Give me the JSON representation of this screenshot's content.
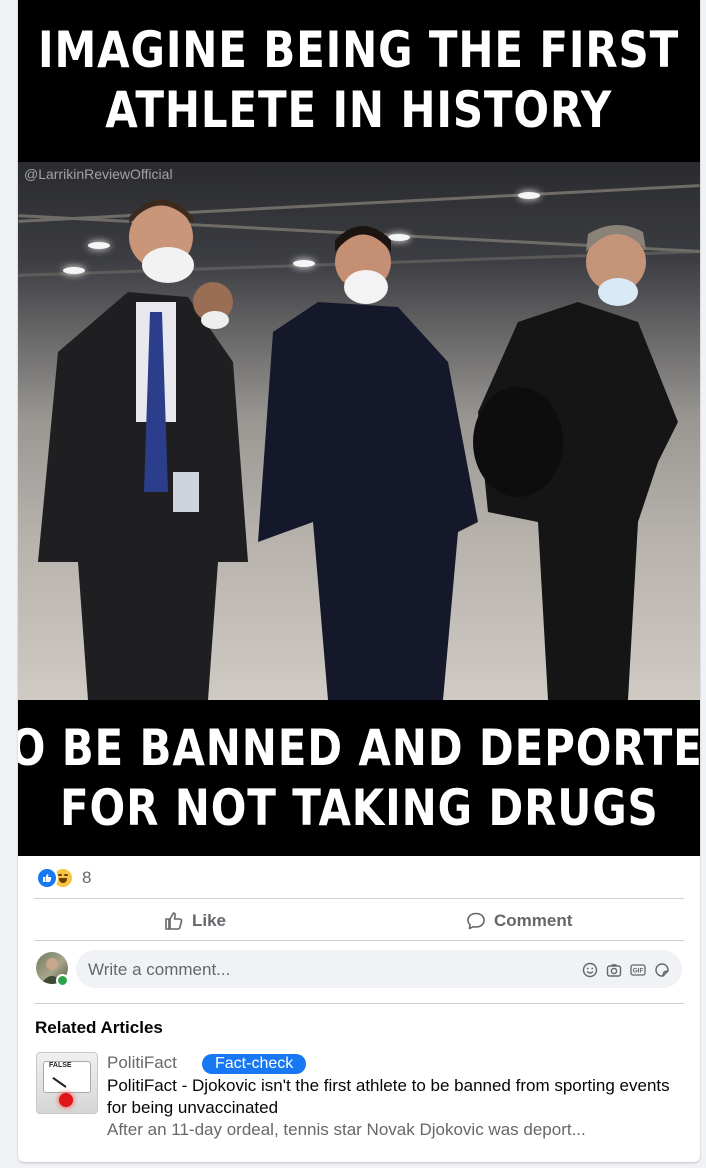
{
  "meme": {
    "top_line_1": "IMAGINE BEING THE FIRST",
    "top_line_2": "ATHLETE IN HISTORY",
    "bottom_line_1": "TO BE BANNED AND DEPORTED",
    "bottom_line_2": "FOR NOT TAKING DRUGS",
    "watermark": "@LarrikinReviewOfficial"
  },
  "reactions": {
    "icons": [
      "like-icon",
      "haha-icon"
    ],
    "count": "8"
  },
  "actions": {
    "like_label": "Like",
    "comment_label": "Comment"
  },
  "comment_box": {
    "placeholder": "Write a comment...",
    "icons": [
      "emoji-icon",
      "camera-icon",
      "gif-icon",
      "sticker-icon"
    ]
  },
  "related": {
    "heading": "Related Articles",
    "article": {
      "thumb_label": "FALSE",
      "source": "PolitiFact",
      "badge": "Fact-check",
      "title": "PolitiFact - Djokovic isn't the first athlete to be banned from sporting events for being unvaccinated",
      "description": "After an 11-day ordeal, tennis star Novak Djokovic was deport..."
    }
  },
  "colors": {
    "accent": "#1877f2",
    "muted_text": "#65676b",
    "card_bg": "#ffffff",
    "page_bg": "#f0f2f5"
  }
}
